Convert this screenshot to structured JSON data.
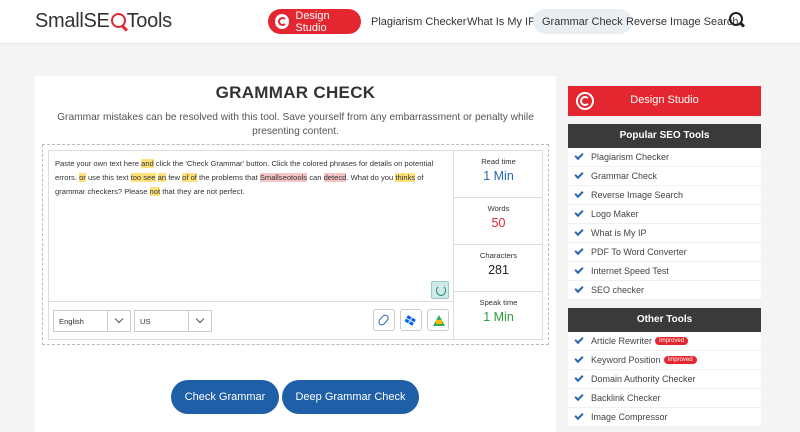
{
  "header": {
    "logo_small": "Small",
    "logo_seo": "SE",
    "logo_tools": "Tools",
    "design_studio": "Design Studio",
    "nav": [
      "Plagiarism Checker",
      "What Is My IP",
      "Grammar Check",
      "Reverse Image Search"
    ],
    "active_nav": "Grammar Check"
  },
  "main": {
    "title": "GRAMMAR CHECK",
    "subtitle": "Grammar mistakes can be resolved with this tool. Save yourself from any embarrassment or penalty while presenting content.",
    "text": {
      "p1": "Paste your own text here ",
      "p2": "and",
      "p3": " click the 'Check Grammar' button. Click the colored phrases for details on potential errors. ",
      "p4": "or",
      "p5": " use this text ",
      "p6": "too see",
      "p7": " ",
      "p8": "an",
      "p9": " few ",
      "p10": "of of",
      "p11": " the problems that ",
      "p12": "Smallseotools",
      "p13": " can ",
      "p14": "detecd",
      "p15": ". What do you ",
      "p16": "thinks",
      "p17": " of grammar checkers? Please ",
      "p18": "not",
      "p19": " that they are not perfect."
    },
    "stats": {
      "read_time_label": "Read time",
      "read_time_value": "1 Min",
      "words_label": "Words",
      "words_value": "50",
      "characters_label": "Characters",
      "characters_value": "281",
      "speak_time_label": "Speak time",
      "speak_time_value": "1 Min"
    },
    "language_select": "English",
    "variant_select": "US",
    "check_button": "Check Grammar",
    "deep_check_button": "Deep Grammar Check"
  },
  "sidebar": {
    "design_studio": "Design Studio",
    "popular_title": "Popular SEO Tools",
    "popular": [
      "Plagiarism Checker",
      "Grammar Check",
      "Reverse Image Search",
      "Logo Maker",
      "What is My IP",
      "PDF To Word Converter",
      "Internet Speed Test",
      "SEO checker"
    ],
    "other_title": "Other Tools",
    "other": [
      {
        "label": "Article Rewriter",
        "badge": "Improved"
      },
      {
        "label": "Keyword Position",
        "badge": "Improved"
      },
      {
        "label": "Domain Authority Checker",
        "badge": ""
      },
      {
        "label": "Backlink Checker",
        "badge": ""
      },
      {
        "label": "Image Compressor",
        "badge": ""
      }
    ]
  },
  "colors": {
    "brand_red": "#e3262f",
    "button_blue": "#1e5fa8",
    "highlight_yellow": "#ffe27a",
    "highlight_red": "#f6c5c5"
  }
}
